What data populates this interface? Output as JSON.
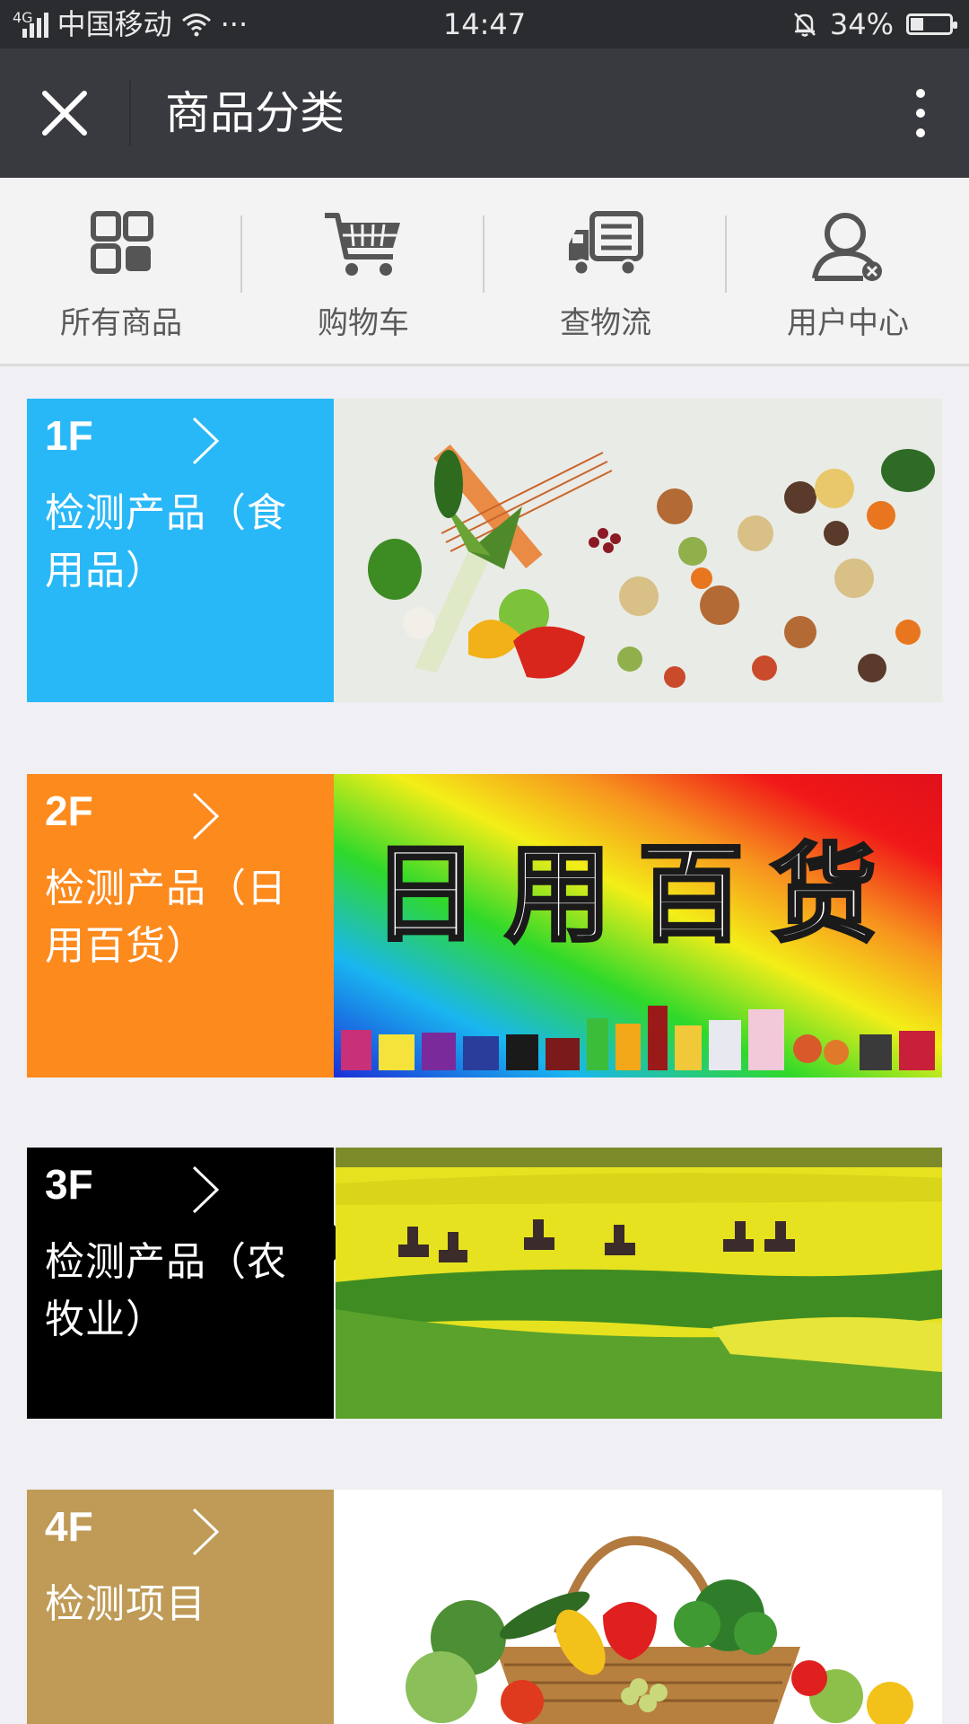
{
  "status_bar": {
    "network": "4G",
    "carrier": "中国移动",
    "more": "···",
    "time": "14:47",
    "battery": "34%",
    "battery_level": 0.34
  },
  "title_bar": {
    "title": "商品分类",
    "close_icon": "close-icon",
    "more_icon": "more-vertical-icon"
  },
  "nav": {
    "items": [
      {
        "label": "所有商品",
        "icon": "grid-icon"
      },
      {
        "label": "购物车",
        "icon": "cart-icon"
      },
      {
        "label": "查物流",
        "icon": "truck-icon"
      },
      {
        "label": "用户中心",
        "icon": "user-icon"
      }
    ]
  },
  "floors": [
    {
      "floor": "1F",
      "name": "检测产品（食用品）",
      "color": "#29b8f7",
      "image": "food-ingredients-image"
    },
    {
      "floor": "2F",
      "name": "检测产品（日用百货）",
      "color": "#fd8a1d",
      "image": "daily-goods-banner-image",
      "banner_text": "日用百货"
    },
    {
      "floor": "3F",
      "name": "检测产品（农牧业）",
      "color": "#000000",
      "image": "rapeseed-field-riders-image"
    },
    {
      "floor": "4F",
      "name": "检测项目",
      "color": "#bf9b57",
      "image": "vegetable-basket-image"
    }
  ]
}
